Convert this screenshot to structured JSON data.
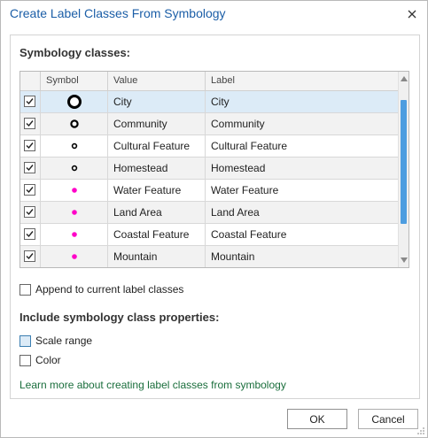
{
  "dialog": {
    "title": "Create Label Classes From Symbology",
    "close_icon": "close-icon"
  },
  "symbology": {
    "section_label": "Symbology classes:",
    "columns": [
      "",
      "Symbol",
      "Value",
      "Label"
    ],
    "rows": [
      {
        "checked": true,
        "symbol": "circle-large-ring",
        "value": "City",
        "label": "City"
      },
      {
        "checked": true,
        "symbol": "circle-medium-ring",
        "value": "Community",
        "label": "Community"
      },
      {
        "checked": true,
        "symbol": "circle-small-ring",
        "value": "Cultural Feature",
        "label": "Cultural Feature"
      },
      {
        "checked": true,
        "symbol": "circle-small-ring",
        "value": "Homestead",
        "label": "Homestead"
      },
      {
        "checked": true,
        "symbol": "magenta-dot",
        "value": "Water Feature",
        "label": "Water Feature"
      },
      {
        "checked": true,
        "symbol": "magenta-dot",
        "value": "Land Area",
        "label": "Land Area"
      },
      {
        "checked": true,
        "symbol": "magenta-dot",
        "value": "Coastal Feature",
        "label": "Coastal Feature"
      },
      {
        "checked": true,
        "symbol": "magenta-dot",
        "value": "Mountain",
        "label": "Mountain"
      }
    ]
  },
  "options": {
    "append_label": "Append to current label classes",
    "append_checked": false,
    "include_label": "Include symbology class properties:",
    "scale_range_label": "Scale range",
    "scale_range_checked": false,
    "color_label": "Color",
    "color_checked": false
  },
  "link": {
    "text": "Learn more about creating label classes from symbology"
  },
  "buttons": {
    "ok": "OK",
    "cancel": "Cancel"
  },
  "colors": {
    "title": "#1b5ea7",
    "selected_row": "#dcebf7",
    "scroll_thumb": "#4d9de0",
    "magenta_symbol": "#ff00c8",
    "link": "#1a6e3c"
  }
}
